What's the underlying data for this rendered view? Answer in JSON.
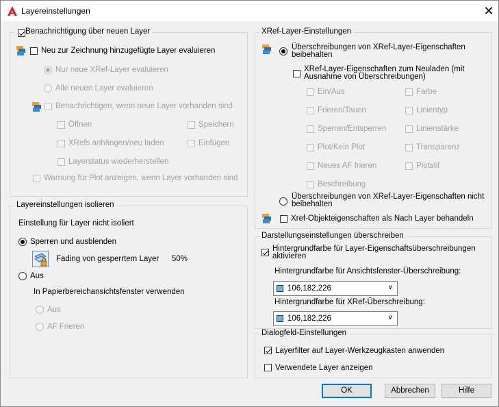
{
  "window": {
    "title": "Layereinstellungen",
    "close_symbol": "✕"
  },
  "notify_group": {
    "title": "Benachrichtigung über neuen Layer",
    "title_checked": true,
    "evaluate_new": "Neu zur Zeichnung hinzugefügte Layer evaluieren",
    "evaluate_new_checked": false,
    "only_xref": "Nur neue XRef-Layer evaluieren",
    "all_new": "Alle neuen Layer evaluieren",
    "notify_when": "Benachrichtigen, wenn neue Layer vorhanden sind",
    "open": "Öffnen",
    "save": "Speichern",
    "xrefs_attach": "XRefs anhängen/neu laden",
    "insert": "Einfügen",
    "restore_state": "Layerstatus wiederherstellen",
    "plot_warning": "Warnung für Plot anzeigen, wenn Layer vorhanden sind"
  },
  "isolate_group": {
    "title": "Layereinstellungen isolieren",
    "setting_label": "Einstellung für Layer nicht isoliert",
    "lock_fade": "Sperren und ausblenden",
    "lock_fade_selected": true,
    "fading_label": "Fading von gesperrtem Layer",
    "fading_value": "50%",
    "off": "Aus",
    "paper_vp": "In Papierbereichansichtsfenster verwenden",
    "paper_off": "Aus",
    "paper_freeze": "AF Frieren"
  },
  "xref_group": {
    "title": "XRef-Layer-Einstellungen",
    "keep_overrides": "Überschreibungen von XRef-Layer-Eigenschaften beibehalten",
    "keep_overrides_selected": true,
    "reload_props": "XRef-Layer-Eigenschaften zum Neuladen (mit Ausnahme von Überschreibungen)",
    "props": {
      "on_off": "Ein/Aus",
      "color": "Farbe",
      "freeze": "Frieren/Tauen",
      "linetype": "Linientyp",
      "lock": "Sperren/Entsperren",
      "lineweight": "Linienstärke",
      "plot": "Plot/Kein Plot",
      "transparency": "Transparenz",
      "vp_freeze": "Neues AF frieren",
      "plotstyle": "Plotstil",
      "description": "Beschreibung"
    },
    "no_keep_overrides": "Überschreibungen von XRef-Layer-Eigenschaften nicht beibehalten",
    "object_props": "Xref-Objekteigenschaften als Nach Layer behandeln"
  },
  "override_group": {
    "title": "Darstellungseinstellungen überschreiben",
    "bg_color": "Hintergrundfarbe für Layer-Eigenschaftsüberschreibungen aktivieren",
    "bg_color_checked": true,
    "vp_label": "Hintergrundfarbe für Ansichtsfenster-Überschreibung:",
    "vp_value": "106,182,226",
    "xref_label": "Hintergrundfarbe für XRef-Überschreibung:",
    "xref_value": "106,182,226",
    "swatch_color": "#6ab6e2"
  },
  "dialog_group": {
    "title": "Dialogfeld-Einstellungen",
    "layer_filter": "Layerfilter auf Layer-Werkzeugkasten anwenden",
    "layer_filter_checked": true,
    "show_used": "Verwendete Layer anzeigen",
    "show_used_checked": false
  },
  "buttons": {
    "ok": "OK",
    "cancel": "Abbrechen",
    "help": "Hilfe"
  }
}
